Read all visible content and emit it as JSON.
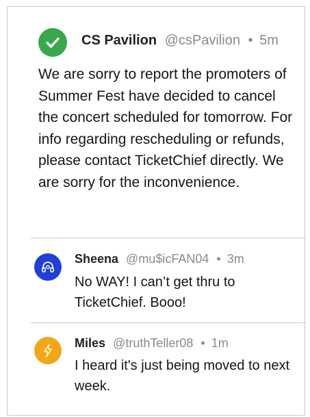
{
  "main_post": {
    "avatar_icon": "checkmark-icon",
    "avatar_color": "#39a84b",
    "author_name": "CS Pavilion",
    "handle": "@csPavilion",
    "separator": "•",
    "time": "5m",
    "body": "We are sorry to report the promoters of Summer Fest have decided to cancel the concert scheduled for tomorrow. For info regarding rescheduling or refunds, please contact TicketChief directly. We are sorry for the inconvenience."
  },
  "replies": [
    {
      "avatar_icon": "headphones-icon",
      "avatar_color": "#1f3fd6",
      "author_name": "Sheena",
      "handle": "@mu$icFAN04",
      "separator": "•",
      "time": "3m",
      "body": "No WAY! I can’t get thru to TicketChief. Booo!"
    },
    {
      "avatar_icon": "lightning-icon",
      "avatar_color": "#f2a71b",
      "author_name": "Miles",
      "handle": "@truthTeller08",
      "separator": "•",
      "time": "1m",
      "body": "I heard it's just being moved to next week."
    }
  ]
}
